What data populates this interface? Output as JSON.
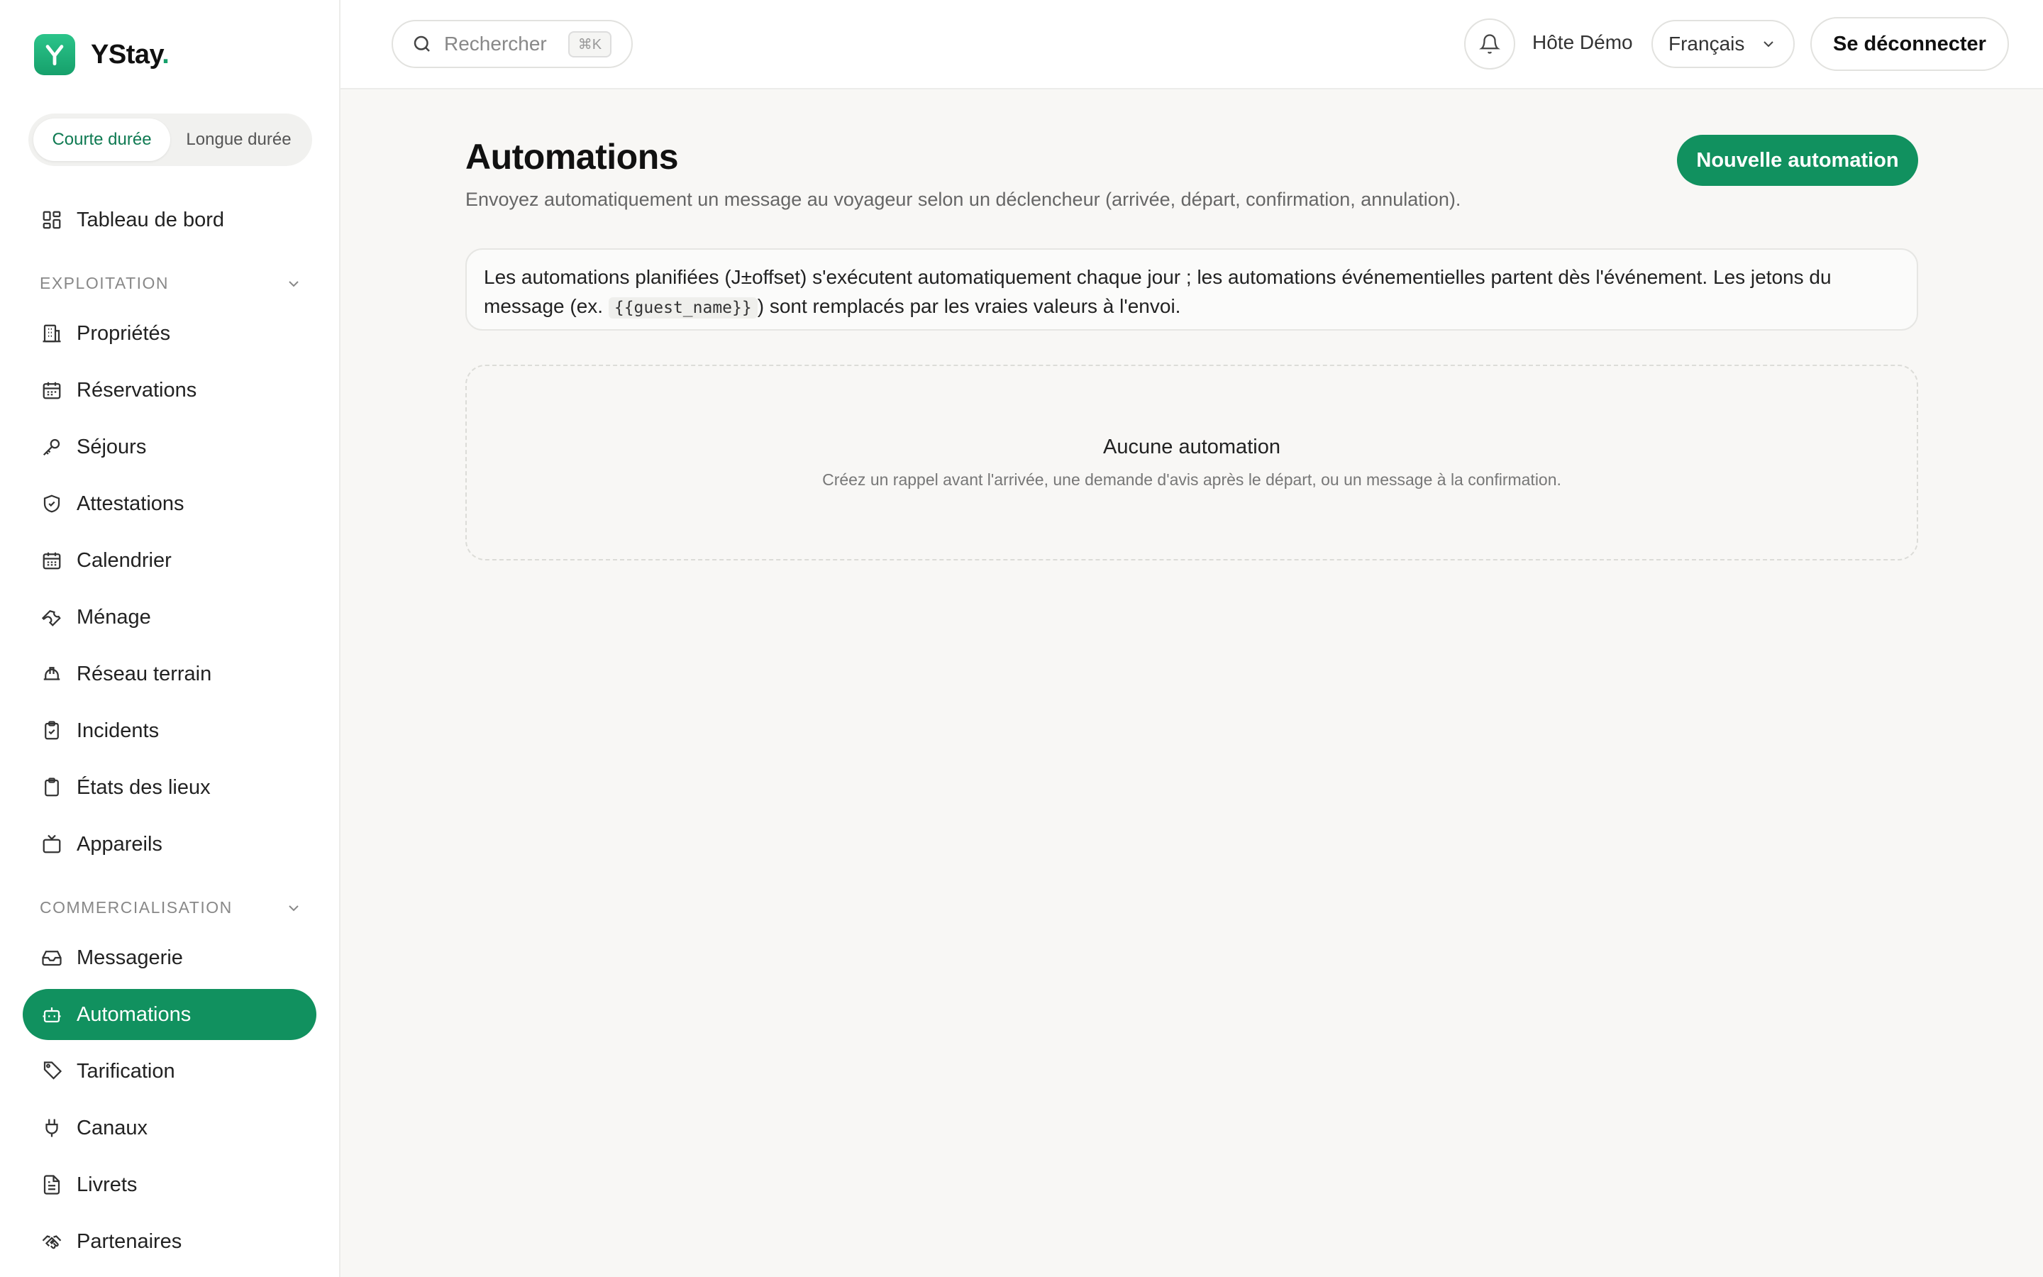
{
  "brand": {
    "name": "YStay",
    "dot": ".",
    "mark": "Y"
  },
  "mode_switch": {
    "short": "Courte durée",
    "long": "Longue durée",
    "active": "short"
  },
  "nav": {
    "dashboard": "Tableau de bord",
    "section_exploitation": "EXPLOITATION",
    "exploitation": [
      {
        "label": "Propriétés",
        "icon": "building-icon"
      },
      {
        "label": "Réservations",
        "icon": "calendar-icon"
      },
      {
        "label": "Séjours",
        "icon": "key-icon"
      },
      {
        "label": "Attestations",
        "icon": "shield-check-icon"
      },
      {
        "label": "Calendrier",
        "icon": "calendar-grid-icon"
      },
      {
        "label": "Ménage",
        "icon": "wrench-icon"
      },
      {
        "label": "Réseau terrain",
        "icon": "hard-hat-icon"
      },
      {
        "label": "Incidents",
        "icon": "clipboard-check-icon"
      },
      {
        "label": "États des lieux",
        "icon": "clipboard-icon"
      },
      {
        "label": "Appareils",
        "icon": "tv-icon"
      }
    ],
    "section_commercialisation": "COMMERCIALISATION",
    "commercialisation": [
      {
        "label": "Messagerie",
        "icon": "inbox-icon"
      },
      {
        "label": "Automations",
        "icon": "bot-icon"
      },
      {
        "label": "Tarification",
        "icon": "tag-icon"
      },
      {
        "label": "Canaux",
        "icon": "plug-icon"
      },
      {
        "label": "Livrets",
        "icon": "file-text-icon"
      },
      {
        "label": "Partenaires",
        "icon": "handshake-icon"
      }
    ],
    "active": "Automations"
  },
  "topbar": {
    "search_placeholder": "Rechercher",
    "search_shortcut": "⌘K",
    "user": "Hôte Démo",
    "language": "Français",
    "logout": "Se déconnecter"
  },
  "page": {
    "title": "Automations",
    "subtitle": "Envoyez automatiquement un message au voyageur selon un déclencheur (arrivée, départ, confirmation, annulation).",
    "new_button": "Nouvelle automation",
    "info_before": "Les automations planifiées (J±offset) s'exécutent automatiquement chaque jour ; les automations événementielles partent dès l'événement. Les jetons du message (ex. ",
    "info_token": "{{guest_name}}",
    "info_after": ") sont remplacés par les vraies valeurs à l'envoi.",
    "empty_title": "Aucune automation",
    "empty_text": "Créez un rappel avant l'arrivée, une demande d'avis après le départ, ou un message à la confirmation."
  },
  "colors": {
    "accent": "#11915f",
    "accent_text": "#0f7a52",
    "background": "#f8f7f5"
  }
}
